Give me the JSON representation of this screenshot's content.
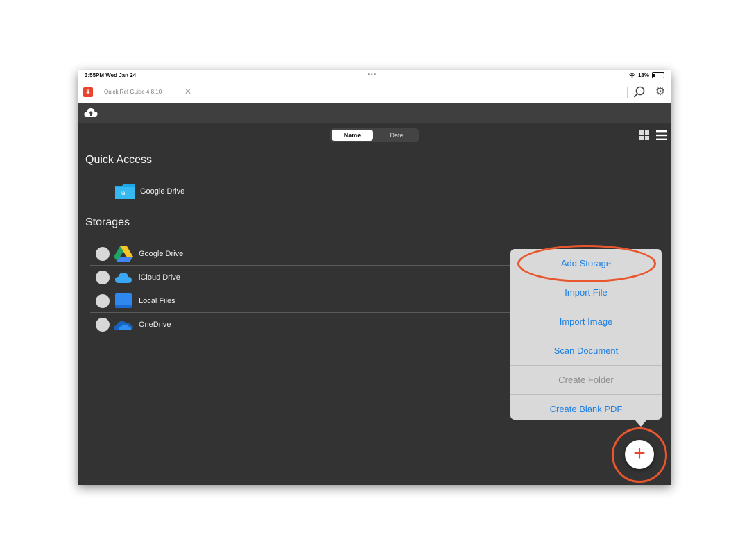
{
  "status_bar": {
    "time": "3:55PM  Wed Jan 24",
    "dots": "•••",
    "battery": "18%"
  },
  "tab": {
    "title": "Quick Ref Guide 4.8.10",
    "close": "✕",
    "logo": "+"
  },
  "toolbar": {
    "cloud_icon": "cloud-upload-icon"
  },
  "sort": {
    "name": "Name",
    "date": "Date",
    "selected": "Name"
  },
  "quick_access": {
    "heading": "Quick Access",
    "items": [
      {
        "label": "Google Drive",
        "icon": "google-drive-folder-icon"
      }
    ]
  },
  "storages": {
    "heading": "Storages",
    "items": [
      {
        "label": "Google Drive",
        "icon": "google-drive-icon"
      },
      {
        "label": "iCloud Drive",
        "icon": "icloud-icon"
      },
      {
        "label": "Local Files",
        "icon": "local-files-icon"
      },
      {
        "label": "OneDrive",
        "icon": "onedrive-icon"
      }
    ]
  },
  "menu": {
    "items": [
      {
        "label": "Add Storage",
        "enabled": true
      },
      {
        "label": "Import File",
        "enabled": true
      },
      {
        "label": "Import Image",
        "enabled": true
      },
      {
        "label": "Scan Document",
        "enabled": true
      },
      {
        "label": "Create Folder",
        "enabled": false
      },
      {
        "label": "Create Blank PDF",
        "enabled": true
      }
    ]
  },
  "fab": {
    "label": "+"
  },
  "colors": {
    "accent": "#e8432b",
    "menu_text": "#1b7fe3",
    "highlight": "#e8562e",
    "background": "#333333"
  }
}
